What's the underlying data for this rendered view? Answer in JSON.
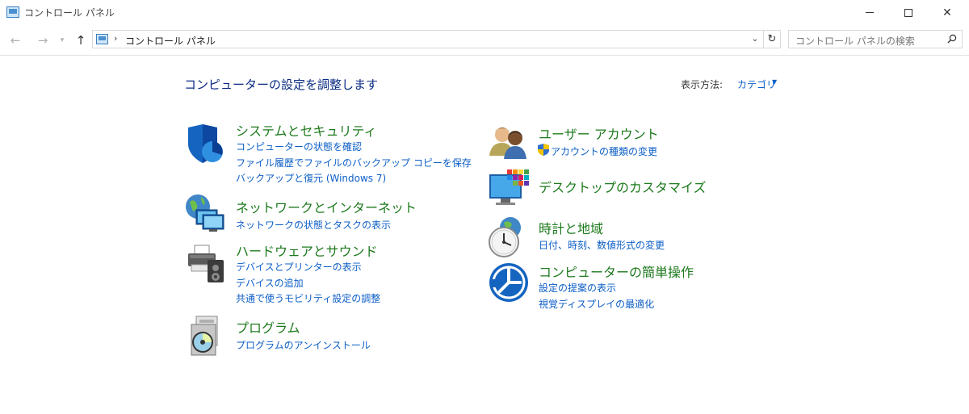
{
  "window": {
    "title": "コントロール パネル"
  },
  "address_bar": {
    "path": "コントロール パネル",
    "search_placeholder": "コントロール パネルの検索"
  },
  "main": {
    "heading": "コンピューターの設定を調整します",
    "view_by_label": "表示方法:",
    "view_by_value": "カテゴリ",
    "categories": [
      {
        "title": "システムとセキュリティ",
        "icon": "shield-icon",
        "links": [
          "コンピューターの状態を確認",
          "ファイル履歴でファイルのバックアップ コピーを保存",
          "バックアップと復元 (Windows 7)"
        ]
      },
      {
        "title": "ネットワークとインターネット",
        "icon": "network-globe-icon",
        "links": [
          "ネットワークの状態とタスクの表示"
        ]
      },
      {
        "title": "ハードウェアとサウンド",
        "icon": "printer-speaker-icon",
        "links": [
          "デバイスとプリンターの表示",
          "デバイスの追加",
          "共通で使うモビリティ設定の調整"
        ]
      },
      {
        "title": "プログラム",
        "icon": "programs-disc-icon",
        "links": [
          "プログラムのアンインストール"
        ]
      },
      {
        "title": "ユーザー アカウント",
        "icon": "users-icon",
        "links": [
          "アカウントの種類の変更"
        ]
      },
      {
        "title": "デスクトップのカスタマイズ",
        "icon": "monitor-palette-icon",
        "links": []
      },
      {
        "title": "時計と地域",
        "icon": "clock-globe-icon",
        "links": [
          "日付、時刻、数値形式の変更"
        ]
      },
      {
        "title": "コンピューターの簡単操作",
        "icon": "ease-of-access-icon",
        "links": [
          "設定の提案の表示",
          "視覚ディスプレイの最適化"
        ]
      }
    ]
  },
  "colors": {
    "link": "#0c5ec7",
    "category_title": "#1e7a1e",
    "heading": "#0a2b82"
  }
}
